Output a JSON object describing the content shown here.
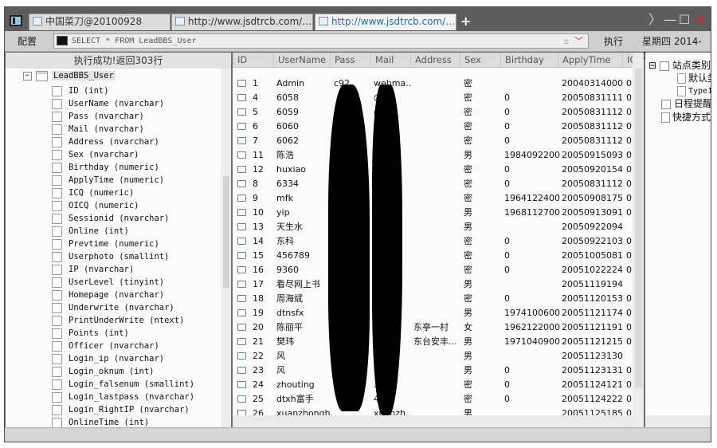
{
  "tabs": [
    {
      "title": "中国菜刀@20100928"
    },
    {
      "title": "http://www.jsdtrcb.com/upfile..."
    },
    {
      "title": "http://www.jsdtrcb.com/upfile..."
    }
  ],
  "window_controls": {
    "forward": "〉",
    "minimize": "—",
    "maximize": "☐",
    "close": "✕"
  },
  "toolbar": {
    "config_label": "配置",
    "sql_query": "SELECT * FROM LeadBBS_User",
    "plus_symbol": "±",
    "dropdown_symbol": "﹀",
    "execute_label": "执行",
    "date_text": "星期四 2014-1..."
  },
  "left": {
    "status_text": "执行成功!返回303行",
    "table_name": "LeadBBS_User",
    "expand_symbol": "−",
    "columns": [
      "ID (int)",
      "UserName (nvarchar)",
      "Pass (nvarchar)",
      "Mail (nvarchar)",
      "Address (nvarchar)",
      "Sex (nvarchar)",
      "Birthday (numeric)",
      "ApplyTime (numeric)",
      "ICQ (numeric)",
      "OICQ (numeric)",
      "Sessionid (nvarchar)",
      "Online (int)",
      "Prevtime (numeric)",
      "Userphoto (smallint)",
      "IP (nvarchar)",
      "UserLevel (tinyint)",
      "Homepage (nvarchar)",
      "Underwrite (nvarchar)",
      "PrintUnderWrite (ntext)",
      "Points (int)",
      "Officer (nvarchar)",
      "Login_ip (nvarchar)",
      "Login_oknum (int)",
      "Login_falsenum (smallint)",
      "Login_lastpass (nvarchar)",
      "Login_RightIP (nvarchar)",
      "OnlineTime (int)"
    ]
  },
  "grid": {
    "headers": [
      "ID",
      "UserName",
      "Pass",
      "Mail",
      "Address",
      "Sex",
      "Birthday",
      "ApplyTime",
      "IC"
    ],
    "rows": [
      {
        "id": "1",
        "username": "Admin",
        "pass": "c92",
        "mail": "webma...",
        "address": "",
        "sex": "密",
        "birthday": "",
        "apply": "20040314000...",
        "icq": "0"
      },
      {
        "id": "4",
        "username": "6058",
        "pass": "",
        "mail": "@...",
        "address": "",
        "sex": "密",
        "birthday": "0",
        "apply": "20050831111...",
        "icq": "0"
      },
      {
        "id": "5",
        "username": "6059",
        "pass": "",
        "mail": "@...",
        "address": "",
        "sex": "密",
        "birthday": "0",
        "apply": "20050831112...",
        "icq": "0"
      },
      {
        "id": "6",
        "username": "6060",
        "pass": "",
        "mail": "@...",
        "address": "",
        "sex": "密",
        "birthday": "0",
        "apply": "20050831112...",
        "icq": "0"
      },
      {
        "id": "7",
        "username": "6062",
        "pass": "",
        "mail": "@...",
        "address": "",
        "sex": "密",
        "birthday": "0",
        "apply": "20050831112...",
        "icq": "0"
      },
      {
        "id": "11",
        "username": "陈浩",
        "pass": "",
        "mail": "n...",
        "address": "",
        "sex": "男",
        "birthday": "1984092200...",
        "apply": "20050915093...",
        "icq": "0"
      },
      {
        "id": "12",
        "username": "huxiao",
        "pass": "",
        "mail": "...",
        "address": "",
        "sex": "密",
        "birthday": "0",
        "apply": "20050920154...",
        "icq": "0"
      },
      {
        "id": "8",
        "username": "6334",
        "pass": "",
        "mail": "...",
        "address": "",
        "sex": "密",
        "birthday": "0",
        "apply": "20050831112...",
        "icq": "0"
      },
      {
        "id": "9",
        "username": "mfk",
        "pass": "",
        "mail": "",
        "address": "",
        "sex": "密",
        "birthday": "1964122400...",
        "apply": "20050908175...",
        "icq": "0"
      },
      {
        "id": "10",
        "username": "yip",
        "pass": "",
        "mail": "",
        "address": "",
        "sex": "男",
        "birthday": "1968112700...",
        "apply": "20050913091...",
        "icq": "0"
      },
      {
        "id": "13",
        "username": "天生水",
        "pass": "",
        "mail": "",
        "address": "",
        "sex": "男",
        "birthday": "",
        "apply": "20050922094...",
        "icq": ""
      },
      {
        "id": "14",
        "username": "东科",
        "pass": "",
        "mail": "",
        "address": "",
        "sex": "密",
        "birthday": "0",
        "apply": "20050922103...",
        "icq": "0"
      },
      {
        "id": "15",
        "username": "456789",
        "pass": "",
        "mail": "",
        "address": "",
        "sex": "密",
        "birthday": "0",
        "apply": "20051005081...",
        "icq": "0"
      },
      {
        "id": "16",
        "username": "9360",
        "pass": "",
        "mail": "",
        "address": "",
        "sex": "密",
        "birthday": "0",
        "apply": "20051022224...",
        "icq": "0"
      },
      {
        "id": "17",
        "username": "看尽网上书",
        "pass": "",
        "mail": "",
        "address": "",
        "sex": "男",
        "birthday": "",
        "apply": "20051119194...",
        "icq": ""
      },
      {
        "id": "18",
        "username": "周海斌",
        "pass": "",
        "mail": "",
        "address": "",
        "sex": "密",
        "birthday": "0",
        "apply": "20051120153...",
        "icq": "0"
      },
      {
        "id": "19",
        "username": "dtnsfx",
        "pass": "",
        "mail": "",
        "address": "",
        "sex": "男",
        "birthday": "1974100600...",
        "apply": "20051121174...",
        "icq": "0"
      },
      {
        "id": "20",
        "username": "陈丽平",
        "pass": "",
        "mail": "0...",
        "address": "东亭一村",
        "sex": "女",
        "birthday": "1962122000...",
        "apply": "20051121191...",
        "icq": "0"
      },
      {
        "id": "21",
        "username": "樊玮",
        "pass": "",
        "mail": "...",
        "address": "东台安丰...",
        "sex": "男",
        "birthday": "1971040900...",
        "apply": "20051121215...",
        "icq": "0"
      },
      {
        "id": "22",
        "username": "风",
        "pass": "",
        "mail": "g...",
        "address": "",
        "sex": "男",
        "birthday": "",
        "apply": "20051123130...",
        "icq": ""
      },
      {
        "id": "23",
        "username": "风",
        "pass": "",
        "mail": "g...",
        "address": "",
        "sex": "男",
        "birthday": "0",
        "apply": "20051123131...",
        "icq": "0"
      },
      {
        "id": "24",
        "username": "zhouting",
        "pass": "",
        "mail": "...",
        "address": "",
        "sex": "密",
        "birthday": "0",
        "apply": "20051124121...",
        "icq": "0"
      },
      {
        "id": "25",
        "username": "dtxh富手",
        "pass": "",
        "mail": "4...",
        "address": "",
        "sex": "密",
        "birthday": "0",
        "apply": "20051124222...",
        "icq": "0"
      },
      {
        "id": "26",
        "username": "xuanzhongh...",
        "pass": "",
        "mail": "xuanzh...",
        "address": "",
        "sex": "男",
        "birthday": "",
        "apply": "20051125185...",
        "icq": "0"
      }
    ]
  },
  "right": {
    "expand_symbol": "⊟",
    "site_category": "站点类别",
    "default_item": "默认类",
    "type_item": "Type1",
    "schedule": "日程提醒",
    "shortcut": "快捷方式"
  }
}
